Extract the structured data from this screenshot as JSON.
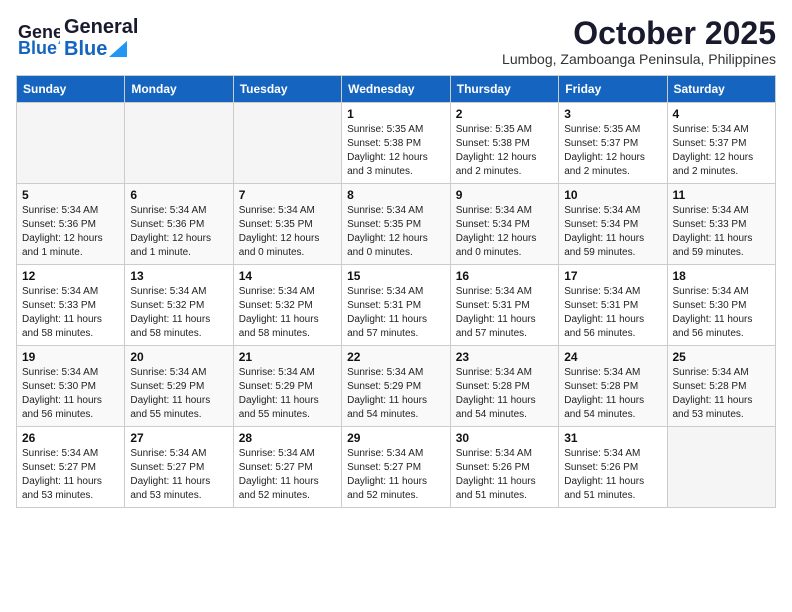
{
  "header": {
    "logo_general": "General",
    "logo_blue": "Blue",
    "month": "October 2025",
    "location": "Lumbog, Zamboanga Peninsula, Philippines"
  },
  "weekdays": [
    "Sunday",
    "Monday",
    "Tuesday",
    "Wednesday",
    "Thursday",
    "Friday",
    "Saturday"
  ],
  "weeks": [
    [
      {
        "day": "",
        "info": ""
      },
      {
        "day": "",
        "info": ""
      },
      {
        "day": "",
        "info": ""
      },
      {
        "day": "1",
        "info": "Sunrise: 5:35 AM\nSunset: 5:38 PM\nDaylight: 12 hours and 3 minutes."
      },
      {
        "day": "2",
        "info": "Sunrise: 5:35 AM\nSunset: 5:38 PM\nDaylight: 12 hours and 2 minutes."
      },
      {
        "day": "3",
        "info": "Sunrise: 5:35 AM\nSunset: 5:37 PM\nDaylight: 12 hours and 2 minutes."
      },
      {
        "day": "4",
        "info": "Sunrise: 5:34 AM\nSunset: 5:37 PM\nDaylight: 12 hours and 2 minutes."
      }
    ],
    [
      {
        "day": "5",
        "info": "Sunrise: 5:34 AM\nSunset: 5:36 PM\nDaylight: 12 hours and 1 minute."
      },
      {
        "day": "6",
        "info": "Sunrise: 5:34 AM\nSunset: 5:36 PM\nDaylight: 12 hours and 1 minute."
      },
      {
        "day": "7",
        "info": "Sunrise: 5:34 AM\nSunset: 5:35 PM\nDaylight: 12 hours and 0 minutes."
      },
      {
        "day": "8",
        "info": "Sunrise: 5:34 AM\nSunset: 5:35 PM\nDaylight: 12 hours and 0 minutes."
      },
      {
        "day": "9",
        "info": "Sunrise: 5:34 AM\nSunset: 5:34 PM\nDaylight: 12 hours and 0 minutes."
      },
      {
        "day": "10",
        "info": "Sunrise: 5:34 AM\nSunset: 5:34 PM\nDaylight: 11 hours and 59 minutes."
      },
      {
        "day": "11",
        "info": "Sunrise: 5:34 AM\nSunset: 5:33 PM\nDaylight: 11 hours and 59 minutes."
      }
    ],
    [
      {
        "day": "12",
        "info": "Sunrise: 5:34 AM\nSunset: 5:33 PM\nDaylight: 11 hours and 58 minutes."
      },
      {
        "day": "13",
        "info": "Sunrise: 5:34 AM\nSunset: 5:32 PM\nDaylight: 11 hours and 58 minutes."
      },
      {
        "day": "14",
        "info": "Sunrise: 5:34 AM\nSunset: 5:32 PM\nDaylight: 11 hours and 58 minutes."
      },
      {
        "day": "15",
        "info": "Sunrise: 5:34 AM\nSunset: 5:31 PM\nDaylight: 11 hours and 57 minutes."
      },
      {
        "day": "16",
        "info": "Sunrise: 5:34 AM\nSunset: 5:31 PM\nDaylight: 11 hours and 57 minutes."
      },
      {
        "day": "17",
        "info": "Sunrise: 5:34 AM\nSunset: 5:31 PM\nDaylight: 11 hours and 56 minutes."
      },
      {
        "day": "18",
        "info": "Sunrise: 5:34 AM\nSunset: 5:30 PM\nDaylight: 11 hours and 56 minutes."
      }
    ],
    [
      {
        "day": "19",
        "info": "Sunrise: 5:34 AM\nSunset: 5:30 PM\nDaylight: 11 hours and 56 minutes."
      },
      {
        "day": "20",
        "info": "Sunrise: 5:34 AM\nSunset: 5:29 PM\nDaylight: 11 hours and 55 minutes."
      },
      {
        "day": "21",
        "info": "Sunrise: 5:34 AM\nSunset: 5:29 PM\nDaylight: 11 hours and 55 minutes."
      },
      {
        "day": "22",
        "info": "Sunrise: 5:34 AM\nSunset: 5:29 PM\nDaylight: 11 hours and 54 minutes."
      },
      {
        "day": "23",
        "info": "Sunrise: 5:34 AM\nSunset: 5:28 PM\nDaylight: 11 hours and 54 minutes."
      },
      {
        "day": "24",
        "info": "Sunrise: 5:34 AM\nSunset: 5:28 PM\nDaylight: 11 hours and 54 minutes."
      },
      {
        "day": "25",
        "info": "Sunrise: 5:34 AM\nSunset: 5:28 PM\nDaylight: 11 hours and 53 minutes."
      }
    ],
    [
      {
        "day": "26",
        "info": "Sunrise: 5:34 AM\nSunset: 5:27 PM\nDaylight: 11 hours and 53 minutes."
      },
      {
        "day": "27",
        "info": "Sunrise: 5:34 AM\nSunset: 5:27 PM\nDaylight: 11 hours and 53 minutes."
      },
      {
        "day": "28",
        "info": "Sunrise: 5:34 AM\nSunset: 5:27 PM\nDaylight: 11 hours and 52 minutes."
      },
      {
        "day": "29",
        "info": "Sunrise: 5:34 AM\nSunset: 5:27 PM\nDaylight: 11 hours and 52 minutes."
      },
      {
        "day": "30",
        "info": "Sunrise: 5:34 AM\nSunset: 5:26 PM\nDaylight: 11 hours and 51 minutes."
      },
      {
        "day": "31",
        "info": "Sunrise: 5:34 AM\nSunset: 5:26 PM\nDaylight: 11 hours and 51 minutes."
      },
      {
        "day": "",
        "info": ""
      }
    ]
  ]
}
